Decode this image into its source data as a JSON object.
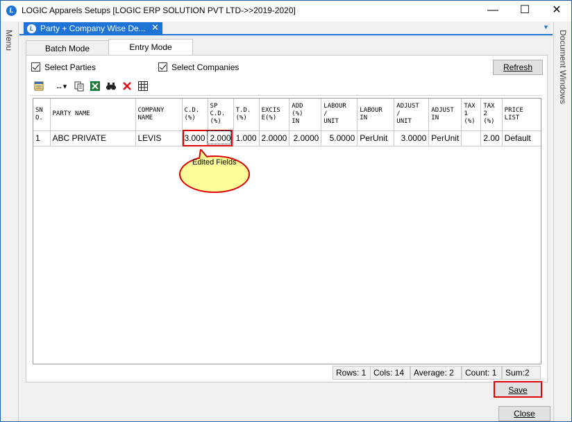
{
  "window": {
    "title": "LOGIC Apparels Setups  [LOGIC ERP SOLUTION PVT LTD->>2019-2020]",
    "app_icon_letter": "L",
    "minimize": "—",
    "maximize": "☐",
    "close": "✕"
  },
  "sidebar_left": {
    "label": "Menu"
  },
  "sidebar_right": {
    "label": "Document Windows"
  },
  "document_tab": {
    "label": "Party + Company Wise De...",
    "close": "✕",
    "dropdown": "▼"
  },
  "mode_tabs": [
    {
      "label": "Batch Mode"
    },
    {
      "label": "Entry Mode"
    }
  ],
  "checkboxes": {
    "select_parties": "Select Parties",
    "select_companies": "Select Companies"
  },
  "buttons": {
    "refresh": "Refresh",
    "save": "Save",
    "close": "Close"
  },
  "toolbar": {
    "icons": [
      "notepad-icon",
      "expand-columns-icon",
      "copy-icon",
      "excel-icon",
      "find-icon",
      "delete-icon",
      "grid-icon"
    ]
  },
  "grid": {
    "headers": [
      [
        "SN",
        "O."
      ],
      [
        "PARTY NAME"
      ],
      [
        "COMPANY",
        "NAME"
      ],
      [
        "C.D.",
        "(%)"
      ],
      [
        "SP",
        "C.D.",
        "(%)"
      ],
      [
        "T.D.",
        "(%)"
      ],
      [
        "EXCIS",
        "E(%)"
      ],
      [
        "ADD",
        "(%)",
        "IN"
      ],
      [
        "LABOUR",
        "/",
        "UNIT"
      ],
      [
        "LABOUR",
        "IN"
      ],
      [
        "ADJUST",
        "/",
        "UNIT"
      ],
      [
        "ADJUST",
        "IN"
      ],
      [
        "TAX",
        "1",
        "(%)"
      ],
      [
        "TAX",
        "2",
        "(%)"
      ],
      [
        "PRICE",
        "LIST"
      ]
    ],
    "rows": [
      [
        "1",
        "ABC PRIVATE",
        "LEVIS",
        "3.000",
        "2.000",
        "1.000",
        "2.0000",
        "2.0000",
        "5.0000",
        "PerUnit",
        "3.0000",
        "PerUnit",
        "",
        "2.00",
        "Default"
      ]
    ]
  },
  "callout": {
    "text": "Edited   Fields"
  },
  "status": {
    "rows": "Rows: 1",
    "cols": "Cols: 14",
    "average": "Average: 2",
    "count": "Count: 1",
    "sum": "Sum:2"
  }
}
